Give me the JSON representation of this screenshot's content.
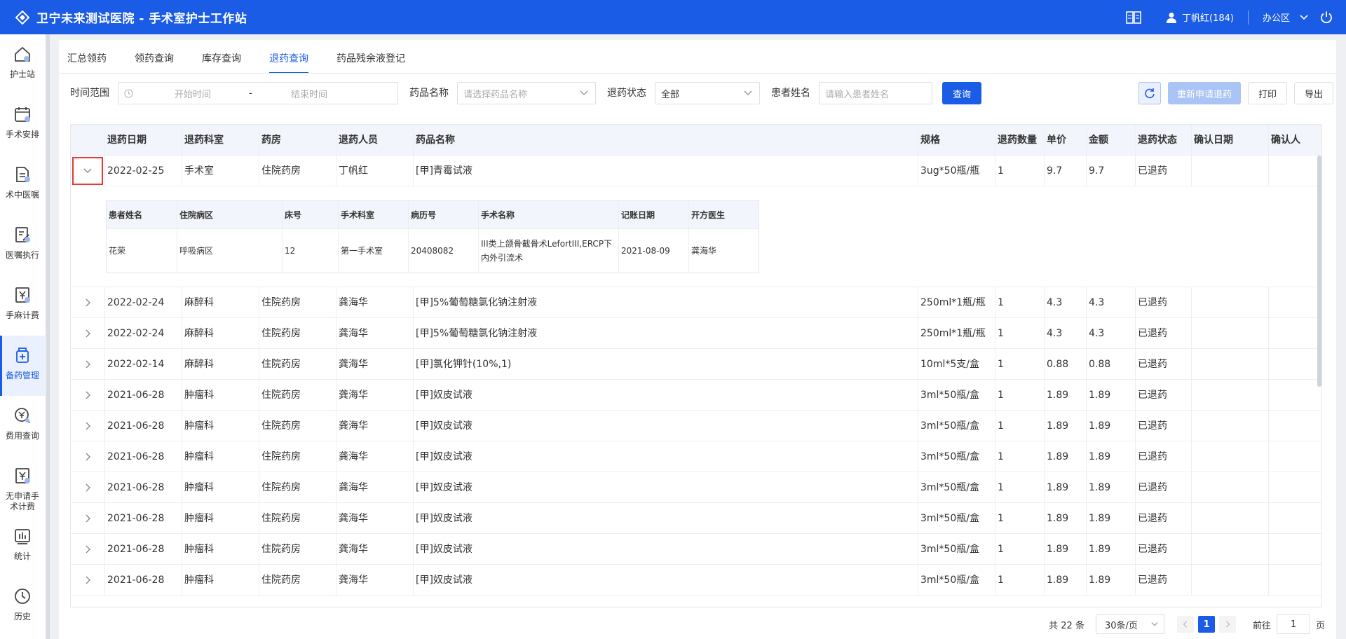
{
  "header": {
    "title": "卫宁未来测试医院 - 手术室护士工作站",
    "user": "丁帆红(184)",
    "area": "办公区"
  },
  "sidebar": {
    "items": [
      {
        "label": "护士站",
        "icon": "nurse-station-icon"
      },
      {
        "label": "手术安排",
        "icon": "calendar-icon"
      },
      {
        "label": "术中医嘱",
        "icon": "document-icon"
      },
      {
        "label": "医嘱执行",
        "icon": "edit-document-icon"
      },
      {
        "label": "手麻计费",
        "icon": "yuan-icon"
      },
      {
        "label": "备药管理",
        "icon": "medicine-icon"
      },
      {
        "label": "费用查询",
        "icon": "yuan-search-icon"
      },
      {
        "label": "无申请手术计费",
        "icon": "yuan-doc-icon"
      },
      {
        "label": "统计",
        "icon": "chart-icon"
      },
      {
        "label": "历史",
        "icon": "clock-icon"
      }
    ]
  },
  "tabs": [
    {
      "label": "汇总领药"
    },
    {
      "label": "领药查询"
    },
    {
      "label": "库存查询"
    },
    {
      "label": "退药查询"
    },
    {
      "label": "药品残余液登记"
    }
  ],
  "filters": {
    "time_label": "时间范围",
    "start_placeholder": "开始时间",
    "range_sep": "-",
    "end_placeholder": "结束时间",
    "drug_label": "药品名称",
    "drug_placeholder": "请选择药品名称",
    "status_label": "退药状态",
    "status_value": "全部",
    "patient_label": "患者姓名",
    "patient_placeholder": "请输入患者姓名",
    "query": "查询",
    "reapply": "重新申请退药",
    "print": "打印",
    "export": "导出"
  },
  "table": {
    "headers": [
      "退药日期",
      "退药科室",
      "药房",
      "退药人员",
      "药品名称",
      "规格",
      "退药数量",
      "单价",
      "金额",
      "退药状态",
      "确认日期",
      "确认人"
    ],
    "rows": [
      [
        "2022-02-25",
        "手术室",
        "住院药房",
        "丁帆红",
        "[甲]青霉试液",
        "3ug*50瓶/瓶",
        "1",
        "9.7",
        "9.7",
        "已退药",
        "",
        ""
      ],
      [
        "2022-02-24",
        "麻醉科",
        "住院药房",
        "龚海华",
        "[甲]5%葡萄糖氯化钠注射液",
        "250ml*1瓶/瓶",
        "1",
        "4.3",
        "4.3",
        "已退药",
        "",
        ""
      ],
      [
        "2022-02-24",
        "麻醉科",
        "住院药房",
        "龚海华",
        "[甲]5%葡萄糖氯化钠注射液",
        "250ml*1瓶/瓶",
        "1",
        "4.3",
        "4.3",
        "已退药",
        "",
        ""
      ],
      [
        "2022-02-14",
        "麻醉科",
        "住院药房",
        "龚海华",
        "[甲]氯化钾针(10%,1)",
        "10ml*5支/盒",
        "1",
        "0.88",
        "0.88",
        "已退药",
        "",
        ""
      ],
      [
        "2021-06-28",
        "肿瘤科",
        "住院药房",
        "龚海华",
        "[甲]奴皮试液",
        "3ml*50瓶/盒",
        "1",
        "1.89",
        "1.89",
        "已退药",
        "",
        ""
      ],
      [
        "2021-06-28",
        "肿瘤科",
        "住院药房",
        "龚海华",
        "[甲]奴皮试液",
        "3ml*50瓶/盒",
        "1",
        "1.89",
        "1.89",
        "已退药",
        "",
        ""
      ],
      [
        "2021-06-28",
        "肿瘤科",
        "住院药房",
        "龚海华",
        "[甲]奴皮试液",
        "3ml*50瓶/盒",
        "1",
        "1.89",
        "1.89",
        "已退药",
        "",
        ""
      ],
      [
        "2021-06-28",
        "肿瘤科",
        "住院药房",
        "龚海华",
        "[甲]奴皮试液",
        "3ml*50瓶/盒",
        "1",
        "1.89",
        "1.89",
        "已退药",
        "",
        ""
      ],
      [
        "2021-06-28",
        "肿瘤科",
        "住院药房",
        "龚海华",
        "[甲]奴皮试液",
        "3ml*50瓶/盒",
        "1",
        "1.89",
        "1.89",
        "已退药",
        "",
        ""
      ],
      [
        "2021-06-28",
        "肿瘤科",
        "住院药房",
        "龚海华",
        "[甲]奴皮试液",
        "3ml*50瓶/盒",
        "1",
        "1.89",
        "1.89",
        "已退药",
        "",
        ""
      ],
      [
        "2021-06-28",
        "肿瘤科",
        "住院药房",
        "龚海华",
        "[甲]奴皮试液",
        "3ml*50瓶/盒",
        "1",
        "1.89",
        "1.89",
        "已退药",
        "",
        ""
      ]
    ],
    "detail": {
      "headers": [
        "患者姓名",
        "住院病区",
        "床号",
        "手术科室",
        "病历号",
        "手术名称",
        "记账日期",
        "开方医生"
      ],
      "row": [
        "花荣",
        "呼吸病区",
        "12",
        "第一手术室",
        "20408082",
        "III类上颌骨截骨术LefortIII,ERCP下内外引流术",
        "2021-08-09",
        "龚海华"
      ]
    }
  },
  "pagination": {
    "total": "共 22 条",
    "page_size": "30条/页",
    "current": "1",
    "goto_label": "前往",
    "goto_value": "1",
    "page_unit": "页"
  },
  "colors": {
    "primary": "#1a5ce6",
    "highlight": "#e53935"
  }
}
